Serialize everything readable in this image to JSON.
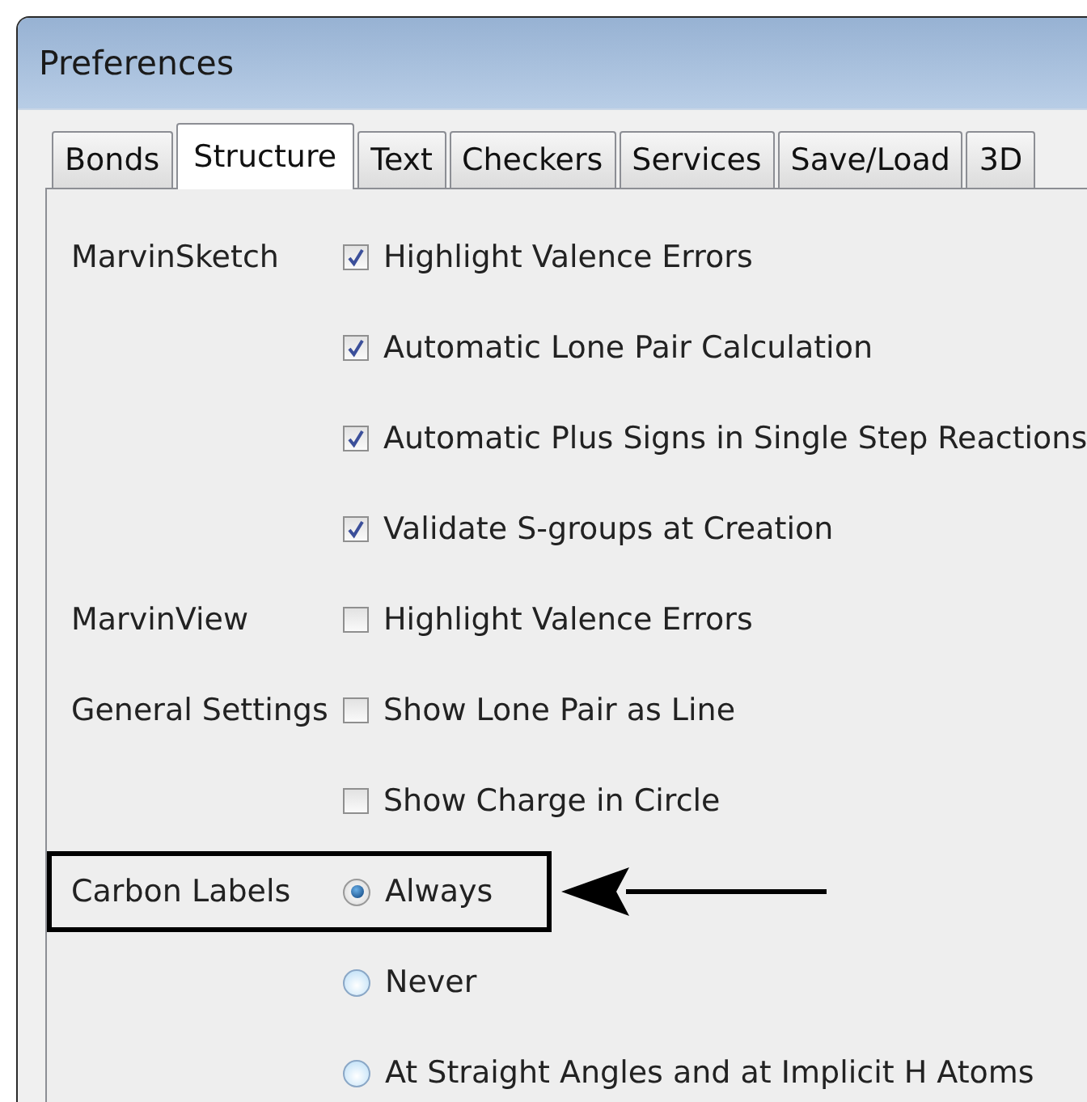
{
  "window": {
    "title": "Preferences"
  },
  "tabs": [
    {
      "label": "Bonds",
      "selected": false
    },
    {
      "label": "Structure",
      "selected": true
    },
    {
      "label": "Text",
      "selected": false
    },
    {
      "label": "Checkers",
      "selected": false
    },
    {
      "label": "Services",
      "selected": false
    },
    {
      "label": "Save/Load",
      "selected": false
    },
    {
      "label": "3D",
      "selected": false
    }
  ],
  "rows": [
    {
      "label": "MarvinSketch",
      "kind": "checkbox",
      "text": "Highlight Valence Errors",
      "checked": true,
      "highlighted": false
    },
    {
      "kind": "checkbox",
      "text": "Automatic Lone Pair Calculation",
      "checked": true,
      "highlighted": false
    },
    {
      "kind": "checkbox",
      "text": "Automatic Plus Signs in Single Step Reactions",
      "checked": true,
      "highlighted": false
    },
    {
      "kind": "checkbox",
      "text": "Validate S-groups at Creation",
      "checked": true,
      "highlighted": false
    },
    {
      "label": "MarvinView",
      "kind": "checkbox",
      "text": "Highlight Valence Errors",
      "checked": false,
      "highlighted": false
    },
    {
      "label": "General Settings",
      "kind": "checkbox",
      "text": "Show Lone Pair as Line",
      "checked": false,
      "highlighted": false
    },
    {
      "kind": "checkbox",
      "text": "Show Charge in Circle",
      "checked": false,
      "highlighted": false
    },
    {
      "label": "Carbon Labels",
      "kind": "radio",
      "text": "Always",
      "selected": true,
      "highlighted": true
    },
    {
      "kind": "radio",
      "text": "Never",
      "selected": false,
      "highlighted": false
    },
    {
      "kind": "radio",
      "text": "At Straight Angles and at Implicit H Atoms",
      "selected": false,
      "highlighted": false
    }
  ]
}
